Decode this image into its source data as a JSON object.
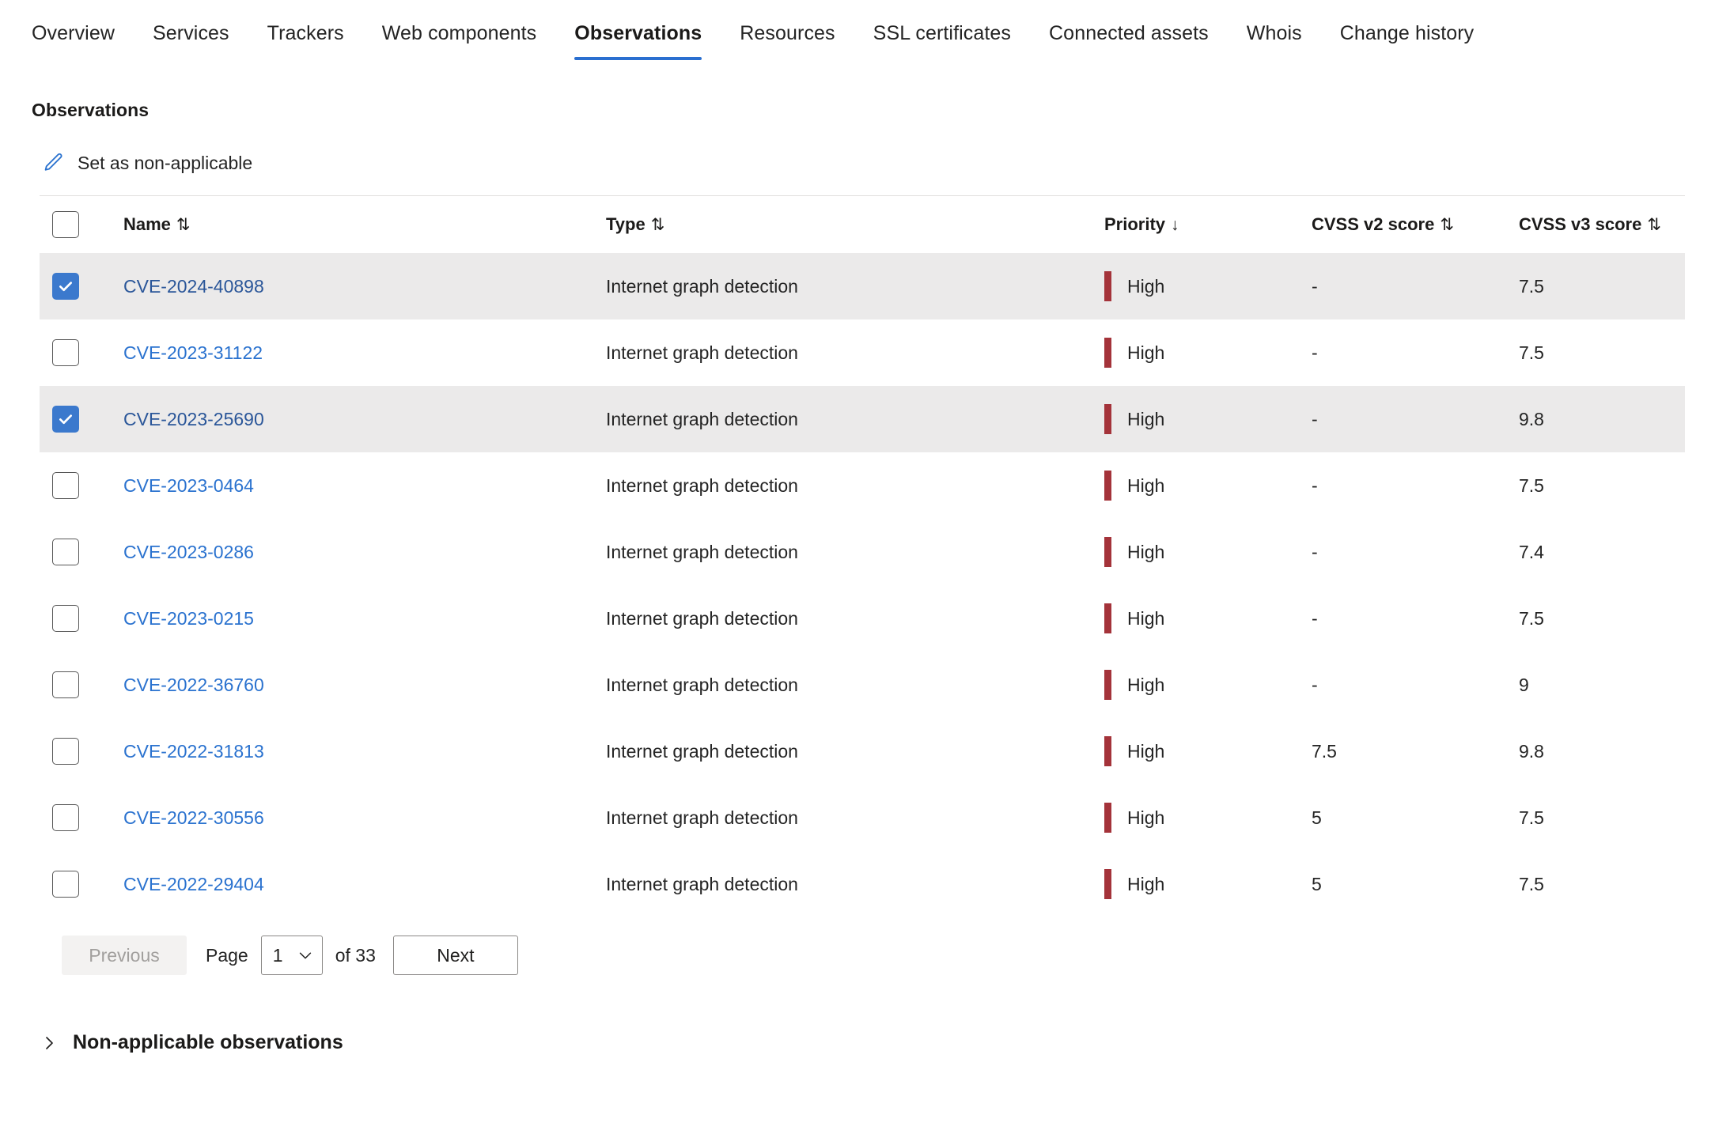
{
  "tabs": [
    {
      "label": "Overview",
      "active": false
    },
    {
      "label": "Services",
      "active": false
    },
    {
      "label": "Trackers",
      "active": false
    },
    {
      "label": "Web components",
      "active": false
    },
    {
      "label": "Observations",
      "active": true
    },
    {
      "label": "Resources",
      "active": false
    },
    {
      "label": "SSL certificates",
      "active": false
    },
    {
      "label": "Connected assets",
      "active": false
    },
    {
      "label": "Whois",
      "active": false
    },
    {
      "label": "Change history",
      "active": false
    }
  ],
  "page": {
    "title": "Observations"
  },
  "commandbar": {
    "set_non_applicable_label": "Set as non-applicable",
    "icon": "pencil-edit-icon",
    "icon_color": "#2a72cf"
  },
  "table": {
    "columns": [
      {
        "key": "name",
        "label": "Name",
        "sort": "unsorted",
        "sort_glyph": "⇅"
      },
      {
        "key": "type",
        "label": "Type",
        "sort": "unsorted",
        "sort_glyph": "⇅"
      },
      {
        "key": "priority",
        "label": "Priority",
        "sort": "descending",
        "sort_glyph": "↓"
      },
      {
        "key": "cvss_v2",
        "label": "CVSS v2 score",
        "sort": "unsorted",
        "sort_glyph": "⇅"
      },
      {
        "key": "cvss_v3",
        "label": "CVSS v3 score",
        "sort": "unsorted",
        "sort_glyph": "⇅"
      }
    ],
    "select_all_checked": false,
    "priority_color": "#a4333a",
    "rows": [
      {
        "name": "CVE-2024-40898",
        "type": "Internet graph detection",
        "priority": "High",
        "cvss_v2": "-",
        "cvss_v3": "7.5",
        "selected": true
      },
      {
        "name": "CVE-2023-31122",
        "type": "Internet graph detection",
        "priority": "High",
        "cvss_v2": "-",
        "cvss_v3": "7.5",
        "selected": false
      },
      {
        "name": "CVE-2023-25690",
        "type": "Internet graph detection",
        "priority": "High",
        "cvss_v2": "-",
        "cvss_v3": "9.8",
        "selected": true
      },
      {
        "name": "CVE-2023-0464",
        "type": "Internet graph detection",
        "priority": "High",
        "cvss_v2": "-",
        "cvss_v3": "7.5",
        "selected": false
      },
      {
        "name": "CVE-2023-0286",
        "type": "Internet graph detection",
        "priority": "High",
        "cvss_v2": "-",
        "cvss_v3": "7.4",
        "selected": false
      },
      {
        "name": "CVE-2023-0215",
        "type": "Internet graph detection",
        "priority": "High",
        "cvss_v2": "-",
        "cvss_v3": "7.5",
        "selected": false
      },
      {
        "name": "CVE-2022-36760",
        "type": "Internet graph detection",
        "priority": "High",
        "cvss_v2": "-",
        "cvss_v3": "9",
        "selected": false
      },
      {
        "name": "CVE-2022-31813",
        "type": "Internet graph detection",
        "priority": "High",
        "cvss_v2": "7.5",
        "cvss_v3": "9.8",
        "selected": false
      },
      {
        "name": "CVE-2022-30556",
        "type": "Internet graph detection",
        "priority": "High",
        "cvss_v2": "5",
        "cvss_v3": "7.5",
        "selected": false
      },
      {
        "name": "CVE-2022-29404",
        "type": "Internet graph detection",
        "priority": "High",
        "cvss_v2": "5",
        "cvss_v3": "7.5",
        "selected": false
      }
    ]
  },
  "pagination": {
    "previous_label": "Previous",
    "previous_disabled": true,
    "page_label": "Page",
    "current_page": "1",
    "of_label": "of 33",
    "total_pages": 33,
    "next_label": "Next",
    "next_disabled": false
  },
  "footer": {
    "expander_label": "Non-applicable observations",
    "expanded": false,
    "icon": "chevron-right-icon"
  }
}
